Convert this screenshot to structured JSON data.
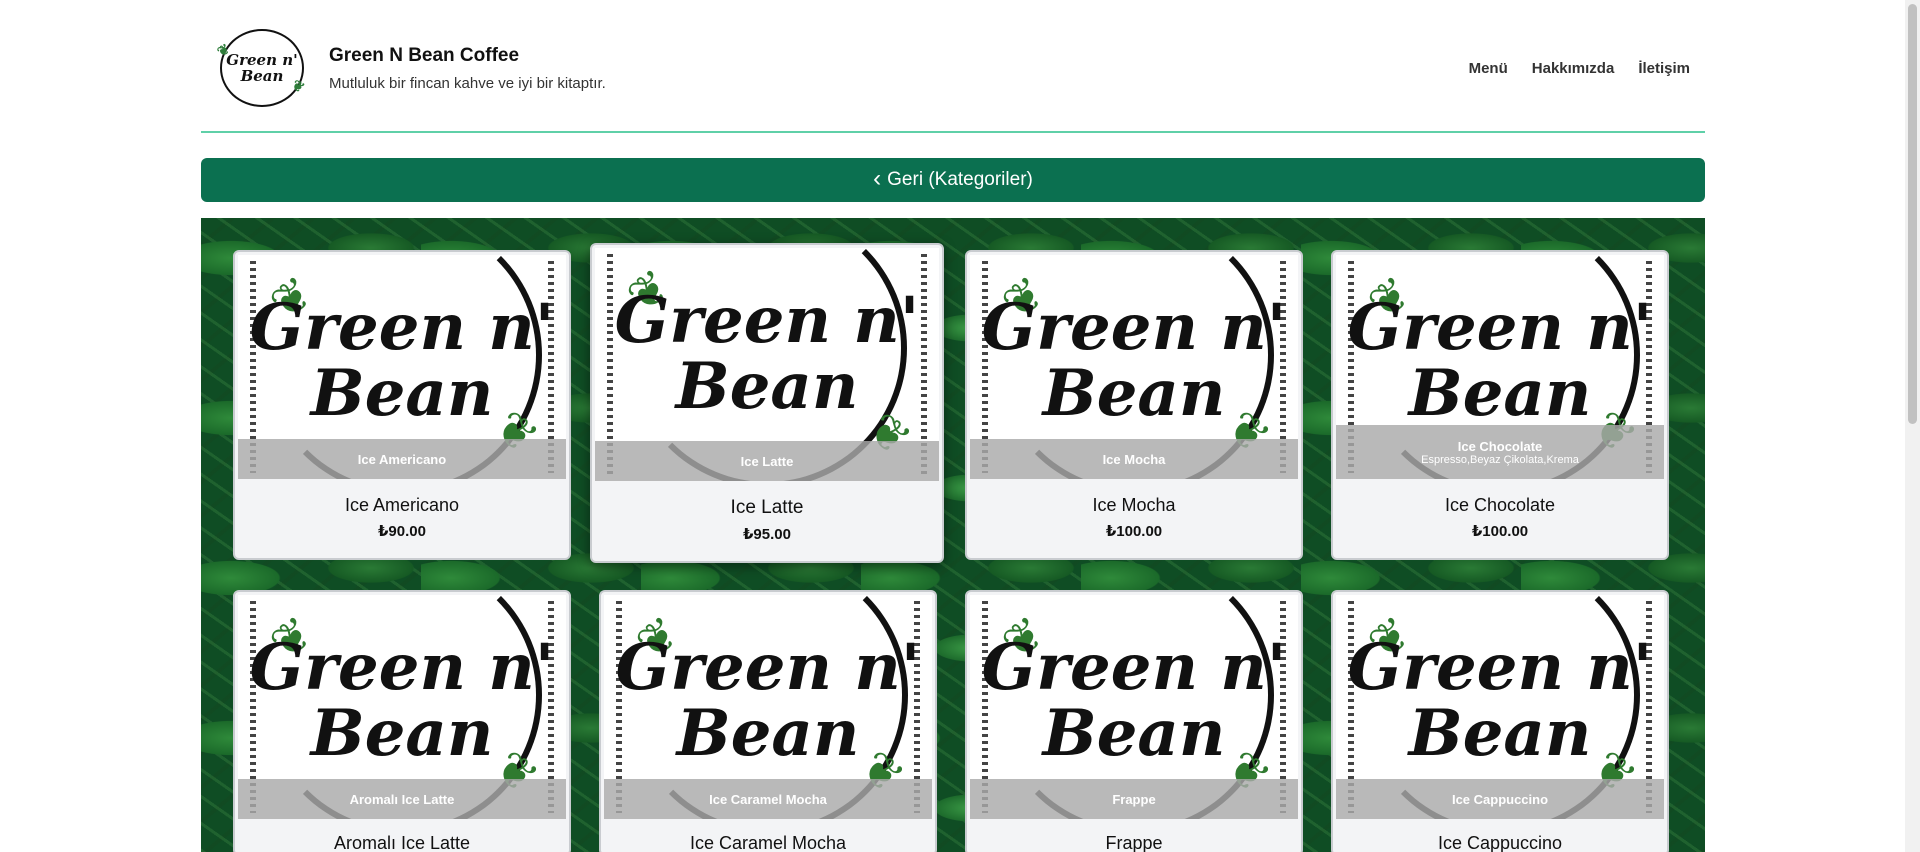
{
  "header": {
    "logo_line1": "Green n'",
    "logo_line2": "Bean",
    "brand_name": "Green N Bean Coffee",
    "tagline": "Mutluluk bir fincan kahve ve iyi bir kitaptır.",
    "nav": [
      "Menü",
      "Hakkımızda",
      "İletişim"
    ]
  },
  "back_button": {
    "label": "Geri (Kategoriler)"
  },
  "card_image": {
    "line1": "Green n'",
    "line2": "Bean"
  },
  "products": [
    {
      "overlay": "Ice Americano",
      "desc": "",
      "name": "Ice Americano",
      "price": "₺90.00"
    },
    {
      "overlay": "Ice Latte",
      "desc": "",
      "name": "Ice Latte",
      "price": "₺95.00"
    },
    {
      "overlay": "Ice Mocha",
      "desc": "",
      "name": "Ice Mocha",
      "price": "₺100.00"
    },
    {
      "overlay": "Ice Chocolate",
      "desc": "Espresso,Beyaz Çikolata,Krema",
      "name": "Ice Chocolate",
      "price": "₺100.00"
    },
    {
      "overlay": "Aromalı Ice Latte",
      "desc": "",
      "name": "Aromalı Ice Latte"
    },
    {
      "overlay": "Ice Caramel Mocha",
      "desc": "",
      "name": "Ice Caramel Mocha"
    },
    {
      "overlay": "Frappe",
      "desc": "",
      "name": "Frappe"
    },
    {
      "overlay": "Ice Cappuccino",
      "desc": "",
      "name": "Ice Cappuccino"
    }
  ],
  "colors": {
    "accent": "#0b7050",
    "divider": "#5fd0a8"
  }
}
